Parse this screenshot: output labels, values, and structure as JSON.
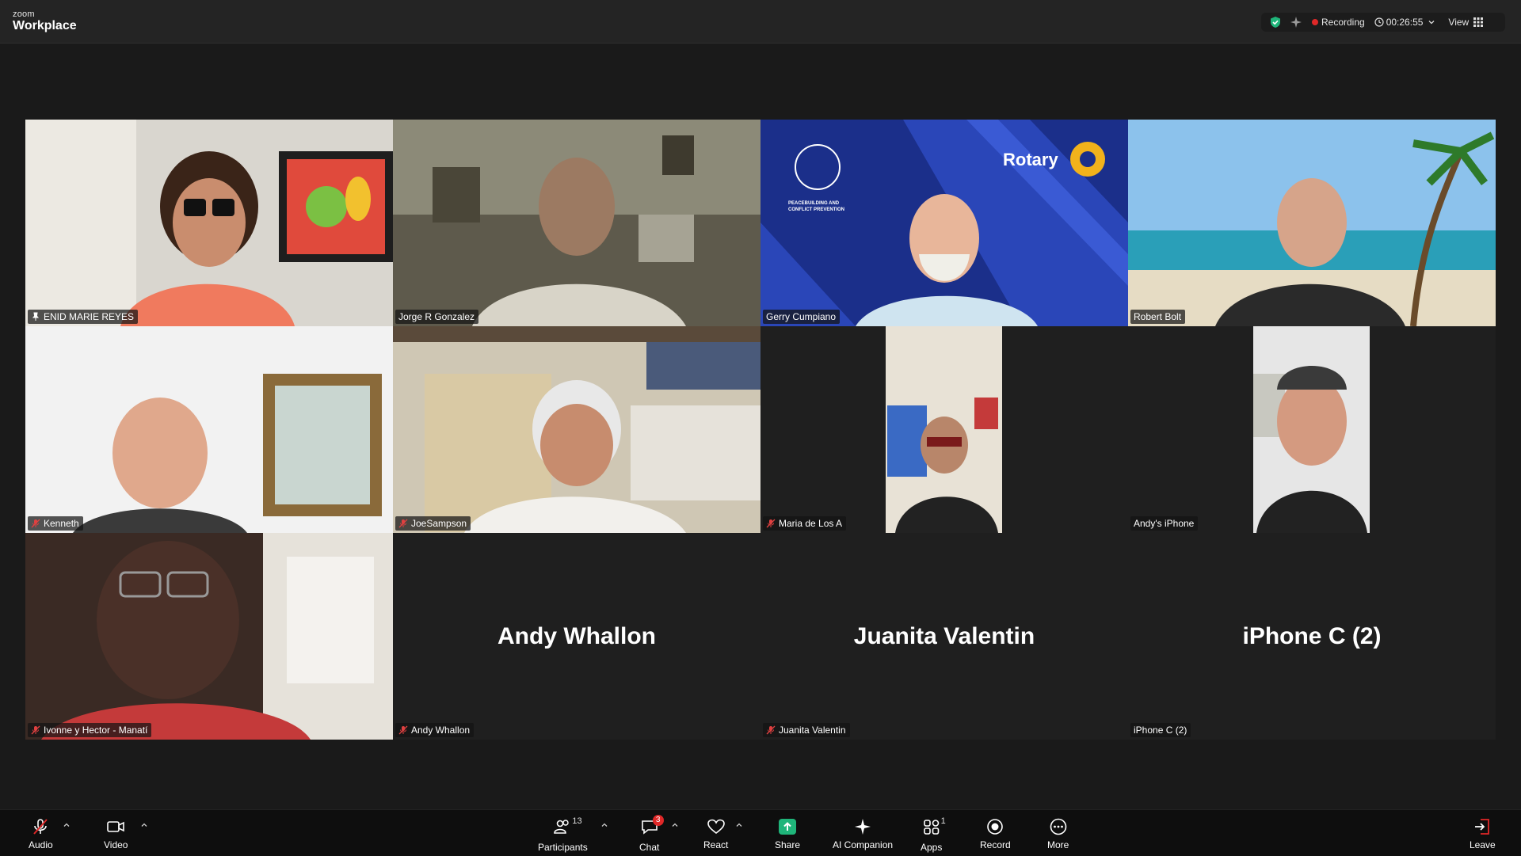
{
  "titlebar": {
    "brand_top": "zoom",
    "brand_bottom": "Workplace",
    "recording_label": "Recording",
    "timer": "00:26:55",
    "view_label": "View"
  },
  "participants": [
    {
      "name": "ENID MARIE REYES",
      "icon": "pin-icon"
    },
    {
      "name": "Jorge R Gonzalez",
      "icon": ""
    },
    {
      "name": "Gerry Cumpiano",
      "icon": ""
    },
    {
      "name": "Robert Bolt",
      "icon": ""
    },
    {
      "name": "Kenneth",
      "icon": "mic-off-icon"
    },
    {
      "name": "JoeSampson",
      "icon": "mic-off-icon"
    },
    {
      "name": "Maria de Los A",
      "icon": "mic-off-icon"
    },
    {
      "name": "Andy's iPhone",
      "icon": ""
    },
    {
      "name": "Ivonne y Hector - Manatí",
      "icon": "mic-off-icon"
    },
    {
      "name": "Andy Whallon",
      "icon": "mic-off-icon",
      "display": "Andy Whallon"
    },
    {
      "name": "Juanita Valentin",
      "icon": "mic-off-icon",
      "display": "Juanita Valentin"
    },
    {
      "name": "iPhone C (2)",
      "icon": "",
      "display": "iPhone C (2)"
    }
  ],
  "background_text": {
    "rotary": "Rotary",
    "peace": "PEACEBUILDING AND CONFLICT PREVENTION"
  },
  "toolbar": {
    "audio": "Audio",
    "video": "Video",
    "participants": "Participants",
    "participants_count": "13",
    "chat": "Chat",
    "chat_badge": "3",
    "react": "React",
    "share": "Share",
    "ai_companion": "AI Companion",
    "apps": "Apps",
    "apps_count": "1",
    "record": "Record",
    "more": "More",
    "leave": "Leave"
  },
  "colors": {
    "active_speaker": "#1fb57a",
    "share_green": "#1fb57a",
    "recording_red": "#e02828",
    "leave_red": "#e02828"
  }
}
